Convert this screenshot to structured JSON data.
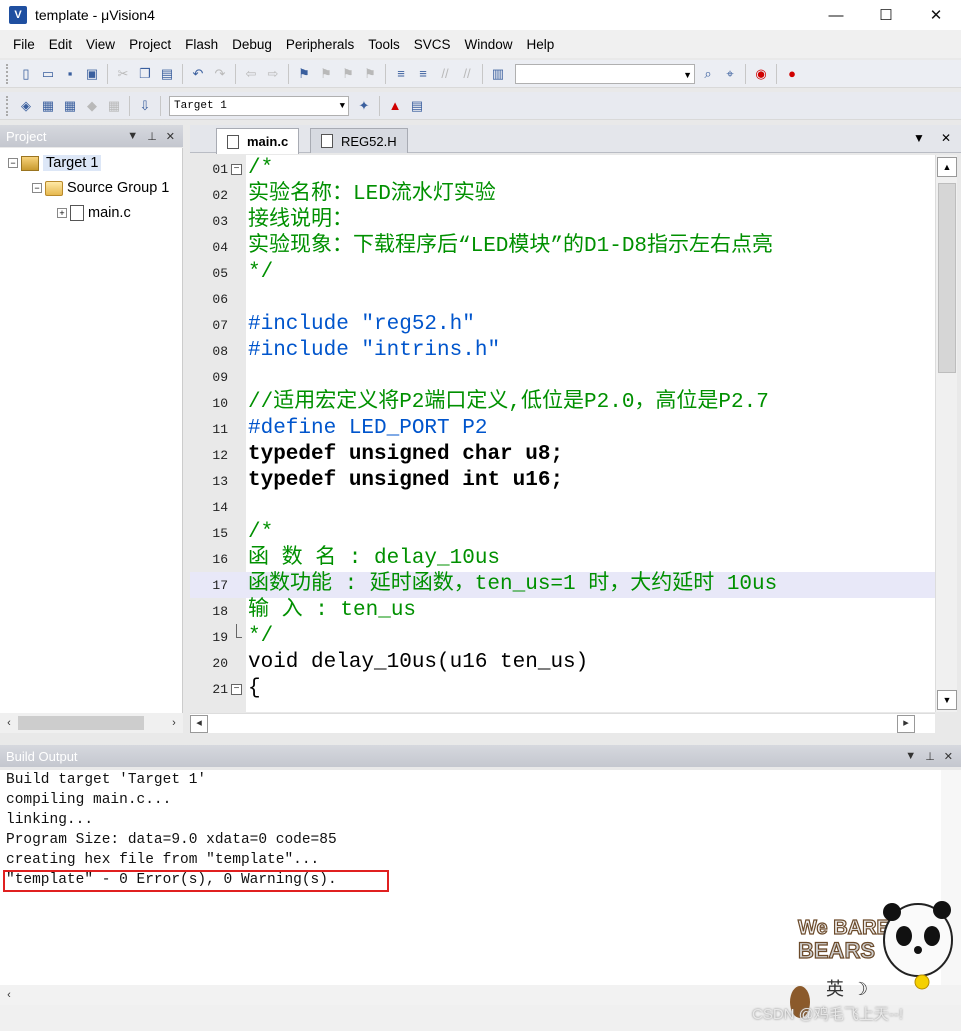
{
  "window": {
    "title": "template  - μVision4",
    "app_icon_glyph": "V",
    "minimize": "—",
    "maximize": "☐",
    "close": "✕"
  },
  "menu": [
    "File",
    "Edit",
    "View",
    "Project",
    "Flash",
    "Debug",
    "Peripherals",
    "Tools",
    "SVCS",
    "Window",
    "Help"
  ],
  "toolbar2": {
    "target_select": "Target 1"
  },
  "project_panel": {
    "title": "Project",
    "tree": [
      {
        "label": "Target 1",
        "exp": "−"
      },
      {
        "label": "Source Group 1",
        "exp": "−"
      },
      {
        "label": "main.c",
        "exp": "+"
      }
    ]
  },
  "editor": {
    "tabs": [
      "main.c",
      "REG52.H"
    ],
    "lines": [
      {
        "n": "01",
        "fold": "open",
        "code": "/*",
        "cls": "c-com"
      },
      {
        "n": "02",
        "code": "实验名称：LED流水灯实验",
        "cls": "c-com"
      },
      {
        "n": "03",
        "code": "接线说明：",
        "cls": "c-com"
      },
      {
        "n": "04",
        "code": "实验现象：下载程序后“LED模块”的D1-D8指示左右点亮",
        "cls": "c-com"
      },
      {
        "n": "05",
        "code": "*/",
        "cls": "c-com"
      },
      {
        "n": "06",
        "code": "",
        "cls": "c-pl"
      },
      {
        "n": "07",
        "code": "#include \"reg52.h\"",
        "cls": "c-pp"
      },
      {
        "n": "08",
        "code": "#include \"intrins.h\"",
        "cls": "c-pp"
      },
      {
        "n": "09",
        "code": "",
        "cls": "c-pl"
      },
      {
        "n": "10",
        "code": "//适用宏定义将P2端口定义,低位是P2.0，高位是P2.7",
        "cls": "c-com"
      },
      {
        "n": "11",
        "code": "#define LED_PORT P2",
        "cls": "c-pp"
      },
      {
        "n": "12",
        "code": "typedef unsigned char u8;",
        "cls": "c-kw"
      },
      {
        "n": "13",
        "code": "typedef unsigned int u16;",
        "cls": "c-kw"
      },
      {
        "n": "14",
        "code": "",
        "cls": "c-pl"
      },
      {
        "n": "15",
        "code": "/*",
        "cls": "c-com"
      },
      {
        "n": "16",
        "code": "函 数 名 : delay_10us",
        "cls": "c-com"
      },
      {
        "n": "17",
        "code": "函数功能 : 延时函数，ten_us=1 时，大约延时 10us",
        "cls": "c-com",
        "hl": true
      },
      {
        "n": "18",
        "code": "输 入 : ten_us",
        "cls": "c-com"
      },
      {
        "n": "19",
        "fold": "end",
        "code": "*/",
        "cls": "c-com"
      },
      {
        "n": "20",
        "code": "void delay_10us(u16 ten_us)",
        "cls": "c-fn"
      },
      {
        "n": "21",
        "fold": "open",
        "code": "{",
        "cls": "c-pl"
      }
    ]
  },
  "build_output": {
    "title": "Build Output",
    "lines": [
      "Build target 'Target 1'",
      "compiling main.c...",
      "linking...",
      "Program Size: data=9.0 xdata=0 code=85",
      "creating hex file from \"template\"...",
      "\"template\" - 0 Error(s), 0 Warning(s)."
    ]
  },
  "sticker": {
    "brand_top": "We BARE",
    "brand_bottom": "BEARS",
    "ime": "英",
    "watermark": "CSDN @鸡毛飞上天--!"
  }
}
